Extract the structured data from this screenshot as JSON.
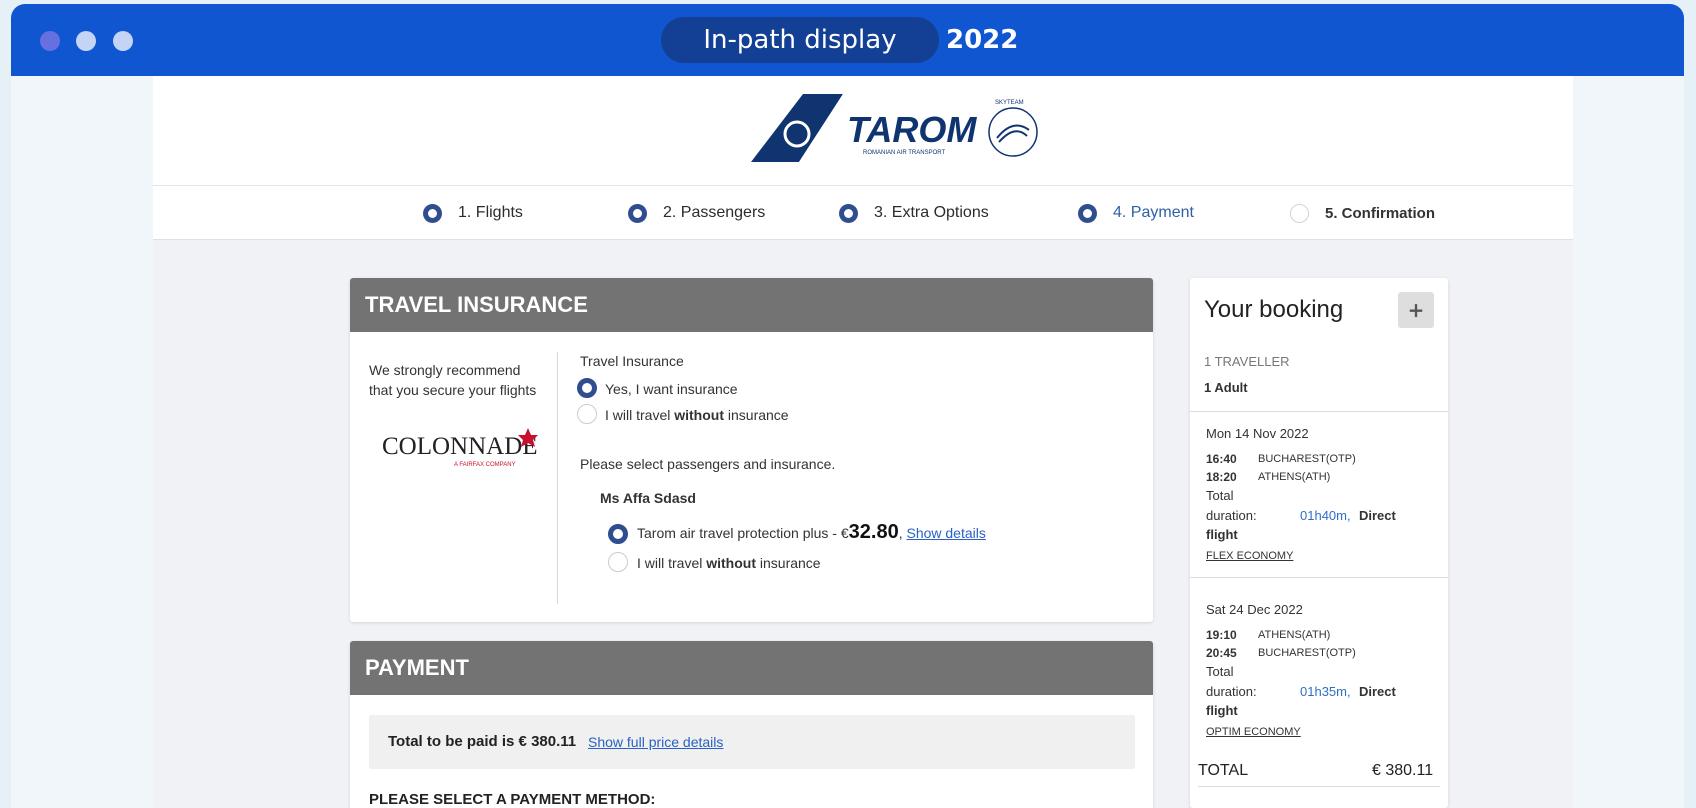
{
  "titlebar": {
    "label": "In-path display",
    "year": "2022"
  },
  "brand": {
    "name": "TAROM",
    "tagline": "ROMANIAN AIR TRANSPORT",
    "alliance": "SKYTEAM"
  },
  "steps": [
    {
      "label": "1. Flights"
    },
    {
      "label": "2. Passengers"
    },
    {
      "label": "3. Extra Options"
    },
    {
      "label": "4. Payment"
    },
    {
      "label": "5. Confirmation"
    }
  ],
  "insurance": {
    "title": "TRAVEL INSURANCE",
    "recommend_1": "We strongly recommend",
    "recommend_2": "that you secure your flights",
    "partner_name": "COLONNADE",
    "partner_sub": "A FAIRFAX COMPANY",
    "section_label": "Travel Insurance",
    "opt_yes": "Yes, I want insurance",
    "opt_no_pre": "I will travel ",
    "opt_no_bold": "without",
    "opt_no_post": " insurance",
    "select_prompt": "Please select passengers and insurance.",
    "passenger_name": "Ms Affa Sdasd",
    "plan_label": "Tarom air travel protection plus - €",
    "plan_price": "32.80",
    "plan_comma": ",",
    "show_details": "Show details ",
    "pass_no_pre": "I will travel ",
    "pass_no_bold": "without",
    "pass_no_post": " insurance"
  },
  "payment": {
    "title": "PAYMENT",
    "total_text": "Total to be paid is € 380.11",
    "show_full": "Show full price details",
    "select_method": "PLEASE SELECT A PAYMENT METHOD:"
  },
  "booking": {
    "title": "Your booking",
    "plus": "+",
    "travellers_label": "1 TRAVELLER",
    "travellers_value": "1 Adult",
    "outbound": {
      "date": "Mon 14 Nov 2022",
      "dep_time": "16:40",
      "dep_place": "BUCHAREST(OTP)",
      "arr_time": "18:20",
      "arr_place": "ATHENS(ATH)",
      "total": "Total",
      "duration_label": "duration:",
      "duration_value": "01h40m,",
      "direct": "Direct",
      "flight": "flight",
      "fare": "FLEX ECONOMY"
    },
    "inbound": {
      "date": "Sat 24 Dec 2022",
      "dep_time": "19:10",
      "dep_place": "ATHENS(ATH)",
      "arr_time": "20:45",
      "arr_place": "BUCHAREST(OTP)",
      "total": "Total",
      "duration_label": "duration:",
      "duration_value": "01h35m,",
      "direct": "Direct",
      "flight": "flight",
      "fare": "OPTIM ECONOMY"
    },
    "total_label": "TOTAL",
    "total_value": "€ 380.11"
  },
  "colors": {
    "brand_blue": "#1156d1",
    "tarom_navy": "#0f3470",
    "accent_red": "#c8102e",
    "step_active": "#2f5fa5"
  }
}
